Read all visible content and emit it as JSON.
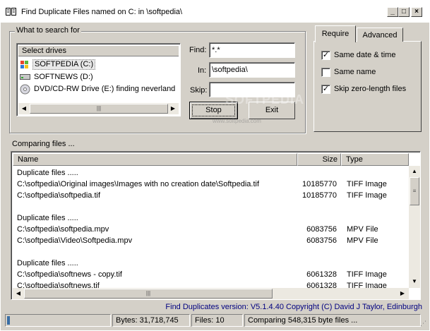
{
  "window": {
    "title": "Find Duplicate Files named  on C: in \\softpedia\\",
    "controls": [
      "_",
      "□",
      "×"
    ]
  },
  "search_group": {
    "label": "What to search for",
    "drives_header": "Select drives",
    "drives": [
      {
        "label": "SOFTPEDIA (C:)",
        "icon": "hard-drive-icon",
        "selected": true
      },
      {
        "label": "SOFTNEWS (D:)",
        "icon": "hard-drive-icon",
        "selected": false
      },
      {
        "label": "DVD/CD-RW Drive (E:) finding neverland",
        "icon": "cd-drive-icon",
        "selected": false
      }
    ],
    "find_label": "Find:",
    "find_value": "*.*",
    "in_label": "In:",
    "in_value": "\\softpedia\\",
    "skip_label": "Skip:",
    "skip_value": "",
    "stop_button": "Stop",
    "exit_button": "Exit"
  },
  "options": {
    "tabs": [
      {
        "label": "Require",
        "active": true
      },
      {
        "label": "Advanced",
        "active": false
      }
    ],
    "checks": [
      {
        "label": "Same date & time",
        "checked": true
      },
      {
        "label": "Same name",
        "checked": false
      },
      {
        "label": "Skip zero-length files",
        "checked": true
      }
    ]
  },
  "results": {
    "label": "Comparing files ...",
    "columns": [
      "Name",
      "Size",
      "Type"
    ],
    "rows": [
      {
        "name": "Duplicate files .....",
        "size": "",
        "type": ""
      },
      {
        "name": "C:\\softpedia\\Original images\\Images with no creation date\\Softpedia.tif",
        "size": "10185770",
        "type": "TIFF Image"
      },
      {
        "name": "C:\\softpedia\\softpedia.tif",
        "size": "10185770",
        "type": "TIFF Image"
      },
      {
        "name": "",
        "size": "",
        "type": ""
      },
      {
        "name": "Duplicate files .....",
        "size": "",
        "type": ""
      },
      {
        "name": "C:\\softpedia\\softpedia.mpv",
        "size": "6083756",
        "type": "MPV File"
      },
      {
        "name": "C:\\softpedia\\Video\\Softpedia.mpv",
        "size": "6083756",
        "type": "MPV File"
      },
      {
        "name": "",
        "size": "",
        "type": ""
      },
      {
        "name": "Duplicate files .....",
        "size": "",
        "type": ""
      },
      {
        "name": "C:\\softpedia\\softnews - copy.tif",
        "size": "6061328",
        "type": "TIFF Image"
      },
      {
        "name": "C:\\softpedia\\softnews.tif",
        "size": "6061328",
        "type": "TIFF Image"
      }
    ]
  },
  "version_text": "Find Duplicates version: V5.1.4.40 Copyright (C) David J Taylor, Edinburgh",
  "watermark": "SOFTPEDIA",
  "watermark_url": "www.softpedia.com",
  "status": {
    "bytes": "Bytes: 31,718,745",
    "files": "Files: 10",
    "message": "Comparing 548,315 byte files ...",
    "progress": 0.03
  },
  "colors": {
    "face": "#d4d0c8",
    "version_text": "#000080",
    "progress": "#3a6ea5",
    "selection": "#e8e8e8"
  }
}
